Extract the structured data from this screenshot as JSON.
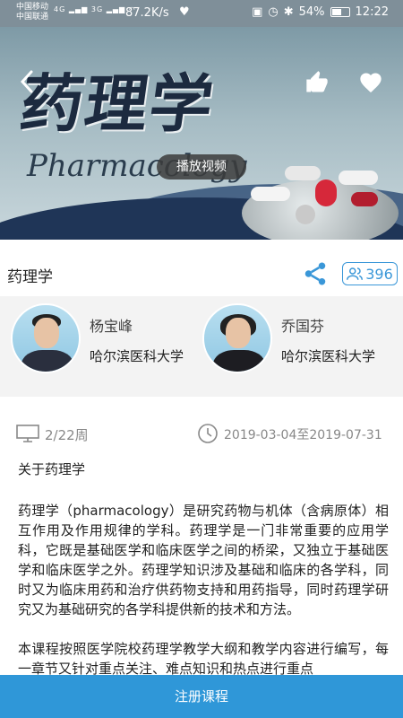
{
  "status_bar": {
    "carrier_1": "中国移动",
    "carrier_2": "中国联通",
    "signal_1": "4G",
    "signal_2": "3G",
    "net_speed": "87.2K/s",
    "battery": "54%",
    "time": "12:22"
  },
  "banner": {
    "title": "药理学",
    "subtitle": "Pharmacology",
    "play_label": "播放视频"
  },
  "course": {
    "name": "药理学",
    "enroll_count": "396"
  },
  "teachers": [
    {
      "name": "杨宝峰",
      "school": "哈尔滨医科大学"
    },
    {
      "name": "乔国芬",
      "school": "哈尔滨医科大学"
    }
  ],
  "meta": {
    "weeks": "2/22周",
    "dates": "2019-03-04至2019-07-31"
  },
  "description": {
    "heading": "关于药理学",
    "para1": "药理学（pharmacology）是研究药物与机体（含病原体）相互作用及作用规律的学科。药理学是一门非常重要的应用学科，它既是基础医学和临床医学之间的桥梁，又独立于基础医学和临床医学之外。药理学知识涉及基础和临床的各学科，同时又为临床用药和治疗供药物支持和用药指导，同时药理学研究又为基础研究的各学科提供新的技术和方法。",
    "para2": "本课程按照医学院校药理学教学大纲和教学内容进行编写，每一章节又针对重点关注、难点知识和热点进行重点"
  },
  "footer": {
    "enroll_label": "注册课程"
  },
  "colors": {
    "accent": "#2f97d8",
    "status_bar": "#7f8f99"
  }
}
